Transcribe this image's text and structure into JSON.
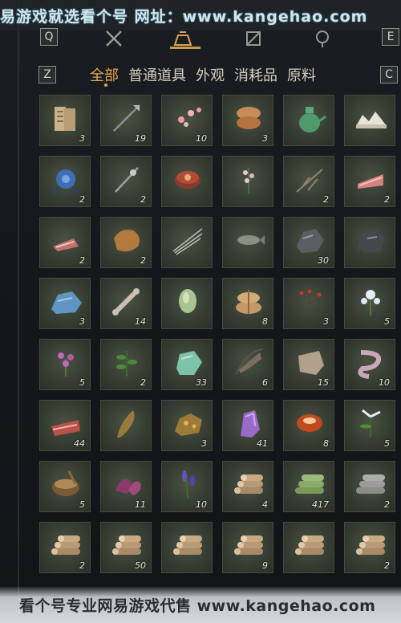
{
  "watermark_top": "易游戏就选看个号  网址：www.kangehao.com",
  "watermark_bottom": "看个号专业网易游戏代售 www.kangehao.com",
  "keys": {
    "q": "Q",
    "e": "E",
    "z": "Z",
    "c": "C"
  },
  "tabs": [
    {
      "label": "全部",
      "active": true
    },
    {
      "label": "普通道具",
      "active": false
    },
    {
      "label": "外观",
      "active": false
    },
    {
      "label": "消耗品",
      "active": false
    },
    {
      "label": "原料",
      "active": false
    }
  ],
  "colors": {
    "accent": "#e3a94b",
    "cell_bg": "#363d33"
  },
  "items": [
    {
      "icon": "scroll-icon",
      "qty": "3"
    },
    {
      "icon": "arrow-icon",
      "qty": "19"
    },
    {
      "icon": "plum-blossom-icon",
      "qty": "10"
    },
    {
      "icon": "pastry-icon",
      "qty": "3"
    },
    {
      "icon": "jade-pot-icon",
      "qty": ""
    },
    {
      "icon": "white-stone-icon",
      "qty": ""
    },
    {
      "icon": "blue-pouch-icon",
      "qty": "2"
    },
    {
      "icon": "ornate-spear-icon",
      "qty": "2"
    },
    {
      "icon": "rouge-box-icon",
      "qty": ""
    },
    {
      "icon": "flower-branch-icon",
      "qty": ""
    },
    {
      "icon": "dry-herb-icon",
      "qty": "2"
    },
    {
      "icon": "raw-meat-icon",
      "qty": "2"
    },
    {
      "icon": "meat-slice-icon",
      "qty": "2"
    },
    {
      "icon": "fur-pelt-icon",
      "qty": "2"
    },
    {
      "icon": "quills-icon",
      "qty": ""
    },
    {
      "icon": "fish-icon",
      "qty": ""
    },
    {
      "icon": "iron-ore-icon",
      "qty": "30"
    },
    {
      "icon": "dark-ore-icon",
      "qty": ""
    },
    {
      "icon": "blue-ore-icon",
      "qty": "3"
    },
    {
      "icon": "bone-icon",
      "qty": "14"
    },
    {
      "icon": "melon-icon",
      "qty": ""
    },
    {
      "icon": "grain-sack-icon",
      "qty": "8"
    },
    {
      "icon": "red-berry-icon",
      "qty": "3"
    },
    {
      "icon": "white-flower-icon",
      "qty": "5"
    },
    {
      "icon": "purple-flower-icon",
      "qty": "5"
    },
    {
      "icon": "green-herb-icon",
      "qty": "2"
    },
    {
      "icon": "jade-stone-icon",
      "qty": "33"
    },
    {
      "icon": "feather-icon",
      "qty": "6"
    },
    {
      "icon": "hide-icon",
      "qty": "15"
    },
    {
      "icon": "intestine-icon",
      "qty": "10"
    },
    {
      "icon": "beef-icon",
      "qty": "44"
    },
    {
      "icon": "carp-icon",
      "qty": ""
    },
    {
      "icon": "gold-ore-icon",
      "qty": "3"
    },
    {
      "icon": "amethyst-icon",
      "qty": "41"
    },
    {
      "icon": "agate-icon",
      "qty": "8"
    },
    {
      "icon": "orchid-icon",
      "qty": "5"
    },
    {
      "icon": "mortar-icon",
      "qty": "5"
    },
    {
      "icon": "purple-leaf-icon",
      "qty": "11"
    },
    {
      "icon": "lavender-icon",
      "qty": "10"
    },
    {
      "icon": "log-pile-icon",
      "qty": "4"
    },
    {
      "icon": "bamboo-log-icon",
      "qty": "417"
    },
    {
      "icon": "grey-log-icon",
      "qty": "2"
    },
    {
      "icon": "log-pile-icon",
      "qty": "2"
    },
    {
      "icon": "log-pile-icon",
      "qty": "50"
    },
    {
      "icon": "log-pile-icon",
      "qty": ""
    },
    {
      "icon": "log-pile-icon",
      "qty": "9"
    },
    {
      "icon": "log-pile-icon",
      "qty": ""
    },
    {
      "icon": "log-pile-icon",
      "qty": "2"
    }
  ]
}
